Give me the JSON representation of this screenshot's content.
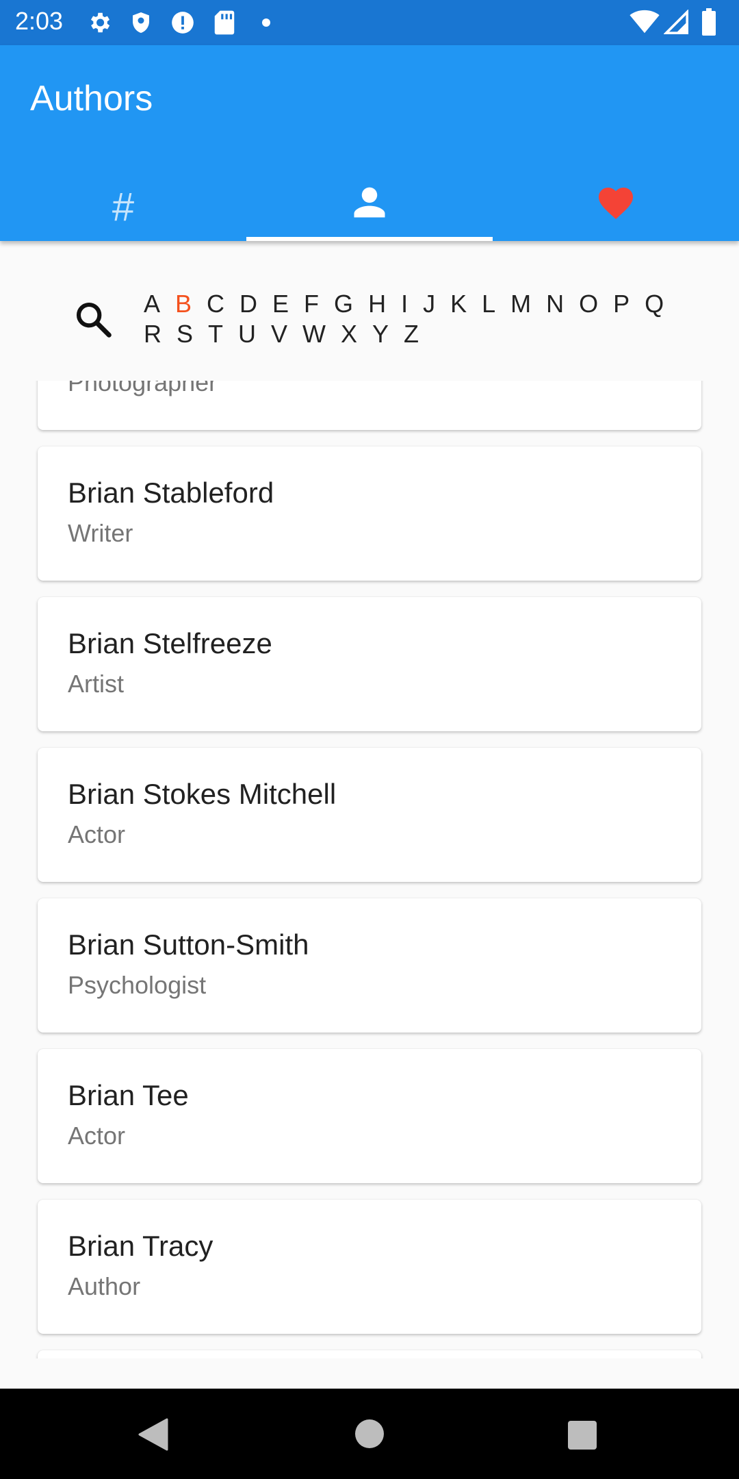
{
  "status_bar": {
    "time": "2:03",
    "left_icons": [
      "gear-icon",
      "shield-icon",
      "alert-icon",
      "sd-card-icon",
      "dot-icon"
    ],
    "right_icons": [
      "wifi-icon",
      "cell-signal-icon",
      "battery-icon"
    ]
  },
  "app_bar": {
    "title": "Authors",
    "tabs": [
      {
        "label": "#",
        "icon": "hash-icon"
      },
      {
        "label": "",
        "icon": "person-icon",
        "selected": true
      },
      {
        "label": "",
        "icon": "heart-icon"
      }
    ]
  },
  "index": {
    "search_icon": "search-icon",
    "letters": [
      "A",
      "B",
      "C",
      "D",
      "E",
      "F",
      "G",
      "H",
      "I",
      "J",
      "K",
      "L",
      "M",
      "N",
      "O",
      "P",
      "Q",
      "R",
      "S",
      "T",
      "U",
      "V",
      "W",
      "X",
      "Y",
      "Z"
    ],
    "selected_letter": "B"
  },
  "authors": [
    {
      "name": "",
      "role": "Photographer"
    },
    {
      "name": "Brian Stableford",
      "role": "Writer"
    },
    {
      "name": "Brian Stelfreeze",
      "role": "Artist"
    },
    {
      "name": "Brian Stokes Mitchell",
      "role": "Actor"
    },
    {
      "name": "Brian Sutton-Smith",
      "role": "Psychologist"
    },
    {
      "name": "Brian Tee",
      "role": "Actor"
    },
    {
      "name": "Brian Tracy",
      "role": "Author"
    }
  ],
  "nav_bar": {
    "icons": [
      "back-icon",
      "home-icon",
      "recents-icon"
    ]
  },
  "colors": {
    "status_bar": "#1976d2",
    "app_bar": "#2196f3",
    "accent_letter": "#f4511e",
    "heart": "#f44336"
  }
}
